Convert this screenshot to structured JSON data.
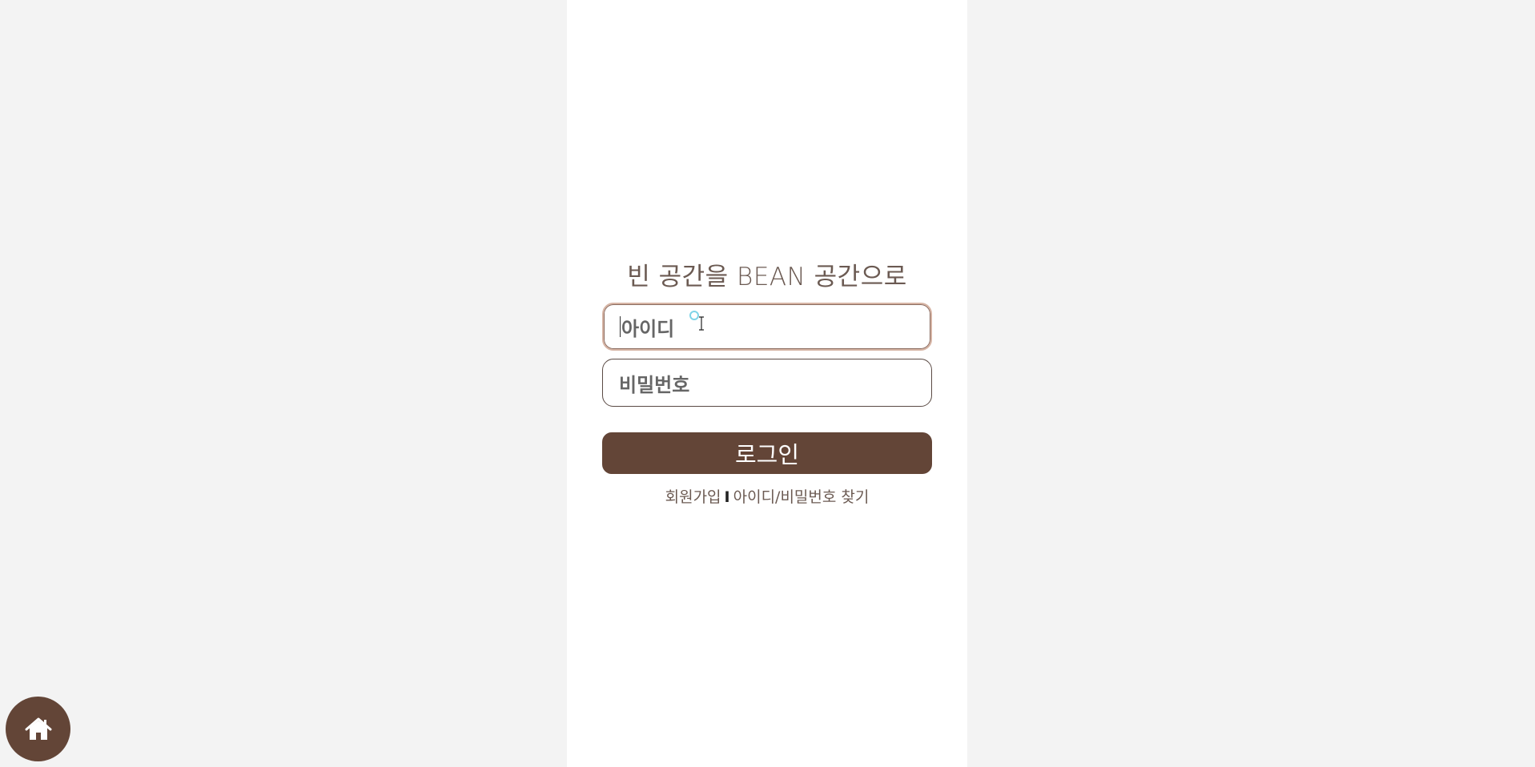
{
  "tagline": "빈 공간을 BEAN 공간으로",
  "form": {
    "id_placeholder": "아이디",
    "password_placeholder": "비밀번호",
    "login_label": "로그인"
  },
  "links": {
    "signup": "회원가입",
    "separator": "I",
    "find_account": "아이디/비밀번호 찾기"
  },
  "home_button": {
    "icon": "home-icon"
  },
  "colors": {
    "brand_brown": "#634537",
    "page_background": "#f3f3f3",
    "text_muted": "#6b5a52"
  }
}
